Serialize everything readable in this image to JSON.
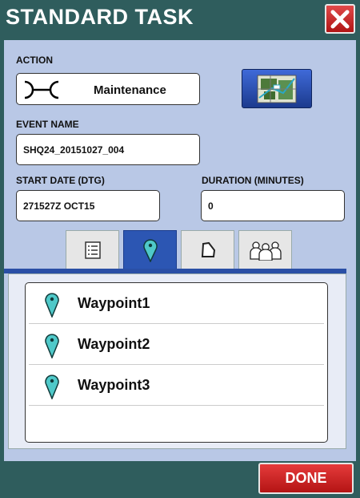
{
  "window": {
    "title": "STANDARD TASK"
  },
  "action": {
    "label": "ACTION",
    "value": "Maintenance"
  },
  "event_name": {
    "label": "EVENT NAME",
    "value": "SHQ24_20151027_004"
  },
  "start_date": {
    "label": "START DATE (DTG)",
    "value": "271527Z OCT15"
  },
  "duration": {
    "label": "DURATION (MINUTES)",
    "value": "0"
  },
  "tabs": [
    {
      "icon": "list-icon"
    },
    {
      "icon": "map-pin-icon",
      "active": true
    },
    {
      "icon": "area-shape-icon"
    },
    {
      "icon": "people-group-icon"
    }
  ],
  "waypoints": [
    {
      "label": "Waypoint1"
    },
    {
      "label": "Waypoint2"
    },
    {
      "label": "Waypoint3"
    }
  ],
  "footer": {
    "done_label": "DONE"
  },
  "colors": {
    "background": "#2f5d5d",
    "panel": "#b9c8e6",
    "accent_blue": "#2c56b3",
    "close_red": "#c62828",
    "pin_teal": "#4fc9c9"
  }
}
